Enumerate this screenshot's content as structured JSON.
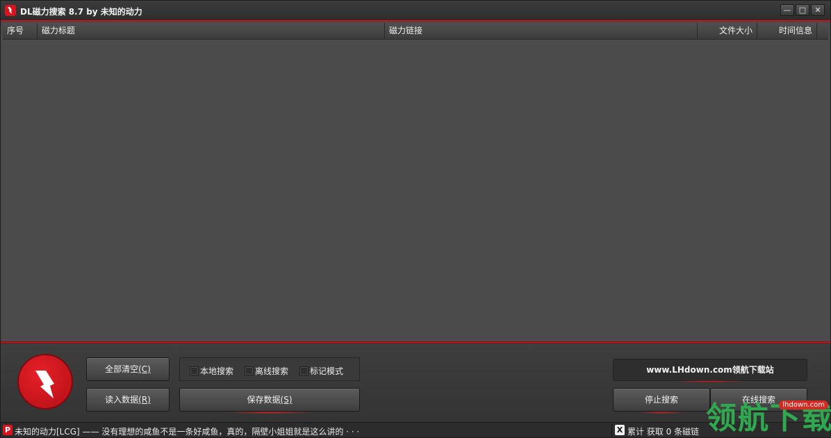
{
  "window": {
    "title": "DL磁力搜索 8.7 by 未知的动力",
    "minimize_icon": "minimize-icon",
    "maximize_icon": "maximize-icon",
    "close_icon": "close-icon"
  },
  "list": {
    "columns": [
      "序号",
      "磁力标题",
      "磁力链接",
      "文件大小",
      "时间信息"
    ]
  },
  "buttons": {
    "clear_all": "全部清空",
    "clear_all_key": "(C)",
    "load_data": "读入数据",
    "load_data_key": "(R)",
    "save_data": "保存数据",
    "save_data_key": "(S)",
    "stop_search": "停止搜索",
    "online_search": "在线搜索"
  },
  "options": {
    "local_search": "本地搜索",
    "offline_search": "离线搜索",
    "mark_mode": "标记模式"
  },
  "site_badge": "www.LHdown.com领航下载站",
  "status": {
    "left_icon_glyph": "P",
    "left_text": "未知的动力[LCG]  ——  没有理想的咸鱼不是一条好咸鱼，真的，隔壁小姐姐就是这么讲的 · · ·",
    "right_icon_glyph": "X",
    "right_text": "累计 获取 0 条磁链"
  },
  "watermark": {
    "text": "领航下载",
    "url": "lhdown.com"
  },
  "colors": {
    "accent": "#c0141c",
    "panel": "#4a4a4a",
    "watermark_green": "#2fa84f"
  }
}
